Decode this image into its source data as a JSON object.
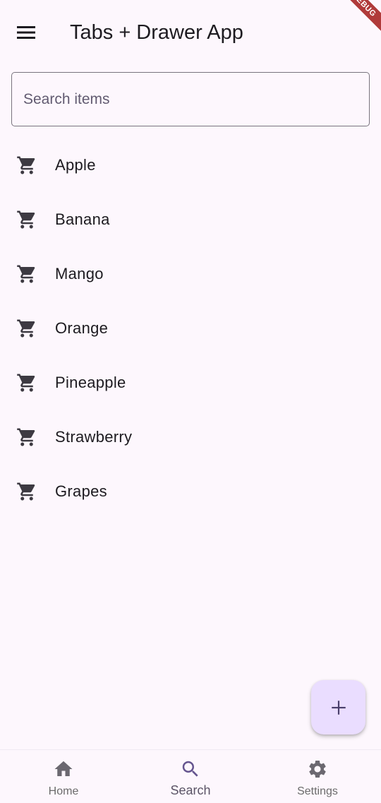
{
  "app_bar": {
    "title": "Tabs + Drawer App",
    "menu_icon": "menu-icon",
    "debug_banner": "DEBUG"
  },
  "search": {
    "placeholder": "Search items",
    "value": ""
  },
  "items": [
    {
      "label": "Apple",
      "icon": "shopping-cart-icon"
    },
    {
      "label": "Banana",
      "icon": "shopping-cart-icon"
    },
    {
      "label": "Mango",
      "icon": "shopping-cart-icon"
    },
    {
      "label": "Orange",
      "icon": "shopping-cart-icon"
    },
    {
      "label": "Pineapple",
      "icon": "shopping-cart-icon"
    },
    {
      "label": "Strawberry",
      "icon": "shopping-cart-icon"
    },
    {
      "label": "Grapes",
      "icon": "shopping-cart-icon"
    }
  ],
  "fab": {
    "icon": "add-icon",
    "color": "#eaddff"
  },
  "bottom_nav": {
    "selected": "Search",
    "items": [
      {
        "label": "Home",
        "icon": "home-icon"
      },
      {
        "label": "Search",
        "icon": "search-icon"
      },
      {
        "label": "Settings",
        "icon": "settings-icon"
      }
    ]
  },
  "colors": {
    "background": "#fdf7fd",
    "accent": "#65558f",
    "debug_ribbon": "#b03a3a"
  }
}
